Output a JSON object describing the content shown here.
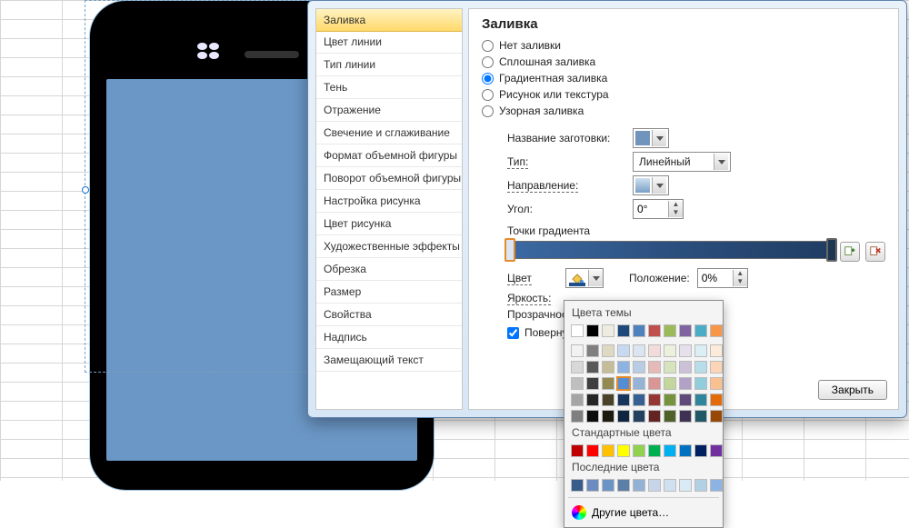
{
  "dialog": {
    "nav": [
      "Заливка",
      "Цвет линии",
      "Тип линии",
      "Тень",
      "Отражение",
      "Свечение и сглаживание",
      "Формат объемной фигуры",
      "Поворот объемной фигуры",
      "Настройка рисунка",
      "Цвет рисунка",
      "Художественные эффекты",
      "Обрезка",
      "Размер",
      "Свойства",
      "Надпись",
      "Замещающий текст"
    ],
    "nav_active_index": 0,
    "title": "Заливка",
    "radios": {
      "none": "Нет заливки",
      "solid": "Сплошная заливка",
      "gradient": "Градиентная заливка",
      "picture": "Рисунок или текстура",
      "pattern": "Узорная заливка"
    },
    "selected_radio": "gradient",
    "labels": {
      "preset": "Название заготовки:",
      "type": "Тип:",
      "direction": "Направление:",
      "angle": "Угол:",
      "stops": "Точки градиента",
      "color": "Цвет",
      "position": "Положение:",
      "brightness": "Яркость:",
      "transparency": "Прозрачность",
      "rotate": "Повернуть в"
    },
    "values": {
      "type": "Линейный",
      "angle": "0°",
      "position": "0%"
    },
    "close": "Закрыть"
  },
  "color_popup": {
    "theme_header": "Цвета темы",
    "standard_header": "Стандартные цвета",
    "recent_header": "Последние цвета",
    "more": "Другие цвета…",
    "theme_row1": [
      "#ffffff",
      "#000000",
      "#eeece1",
      "#1f497d",
      "#4f81bd",
      "#c0504d",
      "#9bbb59",
      "#8064a2",
      "#4bacc6",
      "#f79646"
    ],
    "theme_shades": [
      [
        "#f2f2f2",
        "#7f7f7f",
        "#ddd9c3",
        "#c6d9f0",
        "#dbe5f1",
        "#f2dcdb",
        "#ebf1dd",
        "#e5e0ec",
        "#dbeef3",
        "#fdeada"
      ],
      [
        "#d8d8d8",
        "#595959",
        "#c4bd97",
        "#8db3e2",
        "#b8cce4",
        "#e5b9b7",
        "#d7e3bc",
        "#ccc1d9",
        "#b7dde8",
        "#fbd5b5"
      ],
      [
        "#bfbfbf",
        "#3f3f3f",
        "#938953",
        "#548dd4",
        "#95b3d7",
        "#d99694",
        "#c3d69b",
        "#b2a2c7",
        "#92cddc",
        "#fac08f"
      ],
      [
        "#a5a5a5",
        "#262626",
        "#494429",
        "#17365d",
        "#366092",
        "#953734",
        "#76923c",
        "#5f497a",
        "#31859b",
        "#e36c09"
      ],
      [
        "#7f7f7f",
        "#0c0c0c",
        "#1d1b10",
        "#0f243e",
        "#244061",
        "#632423",
        "#4f6128",
        "#3f3151",
        "#205867",
        "#974806"
      ]
    ],
    "standard": [
      "#c00000",
      "#ff0000",
      "#ffc000",
      "#ffff00",
      "#92d050",
      "#00b050",
      "#00b0f0",
      "#0070c0",
      "#002060",
      "#7030a0"
    ],
    "recent": [
      "#385d8a",
      "#6c8cbf",
      "#6a93c6",
      "#5b7fa6",
      "#93b0d5",
      "#c6d5ea",
      "#cfe0f0",
      "#daeaf6",
      "#b1d0e4",
      "#8db3e2"
    ],
    "selected_index": {
      "row": 2,
      "col": 3
    }
  }
}
